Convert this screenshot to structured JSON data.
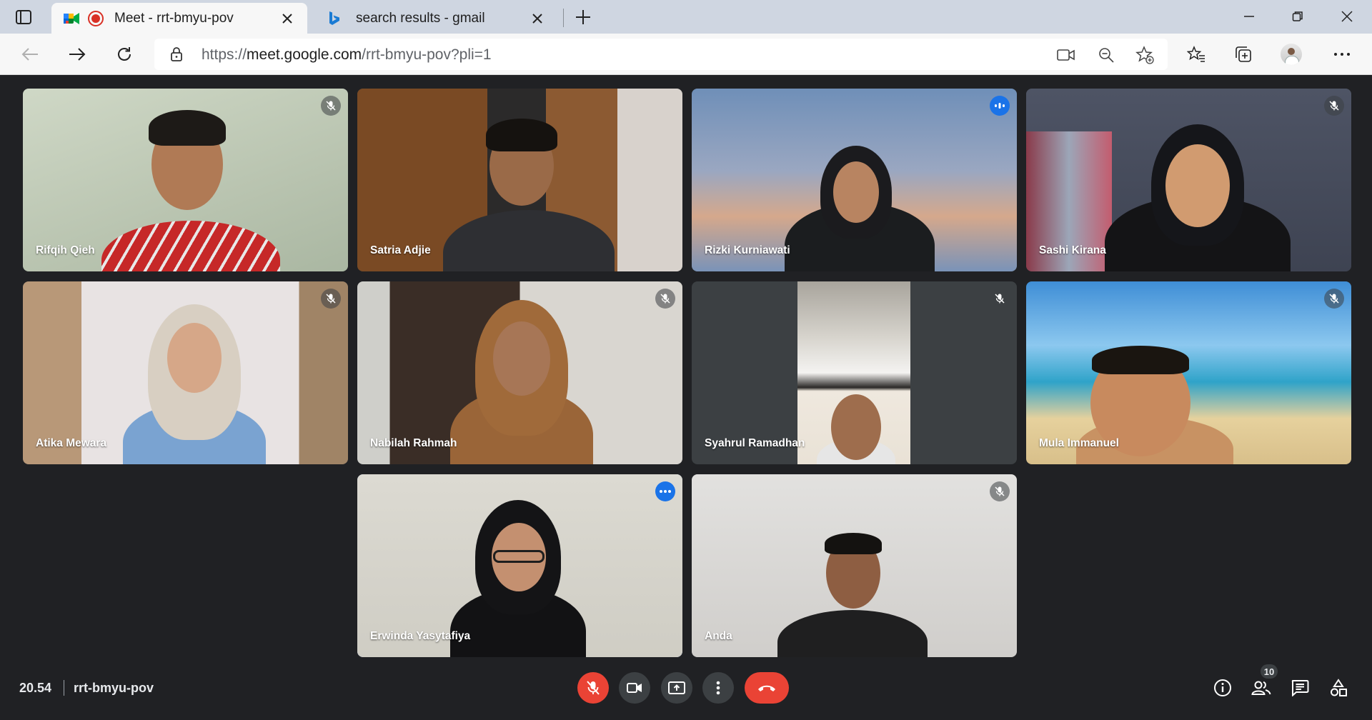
{
  "browser": {
    "tabs": [
      {
        "title": "Meet - rrt-bmyu-pov",
        "active": true,
        "icon": "google-meet-icon",
        "recording": true
      },
      {
        "title": "search results - gmail",
        "active": false,
        "icon": "bing-icon"
      }
    ],
    "url": {
      "prefix": "https://",
      "host": "meet.google.com",
      "path": "/rrt-bmyu-pov?pli=1"
    }
  },
  "meeting": {
    "time": "20.54",
    "code": "rrt-bmyu-pov",
    "participant_count": "10",
    "participants": [
      {
        "name": "Rifqih Qieh",
        "status": "muted"
      },
      {
        "name": "Satria Adjie",
        "status": "none"
      },
      {
        "name": "Rizki Kurniawati",
        "status": "speaking"
      },
      {
        "name": "Sashi Kirana",
        "status": "muted"
      },
      {
        "name": "Atika Mewara",
        "status": "muted"
      },
      {
        "name": "Nabilah Rahmah",
        "status": "muted"
      },
      {
        "name": "Syahrul Ramadhan",
        "status": "muted"
      },
      {
        "name": "Mula Immanuel",
        "status": "muted"
      },
      {
        "name": "Erwinda Yasytafiya",
        "status": "speaking"
      },
      {
        "name": "Anda",
        "status": "muted"
      }
    ]
  },
  "colors": {
    "accent_blue": "#1a73e8",
    "end_call_red": "#ea4335",
    "meet_background": "#202124",
    "control_gray": "#3c4043"
  }
}
